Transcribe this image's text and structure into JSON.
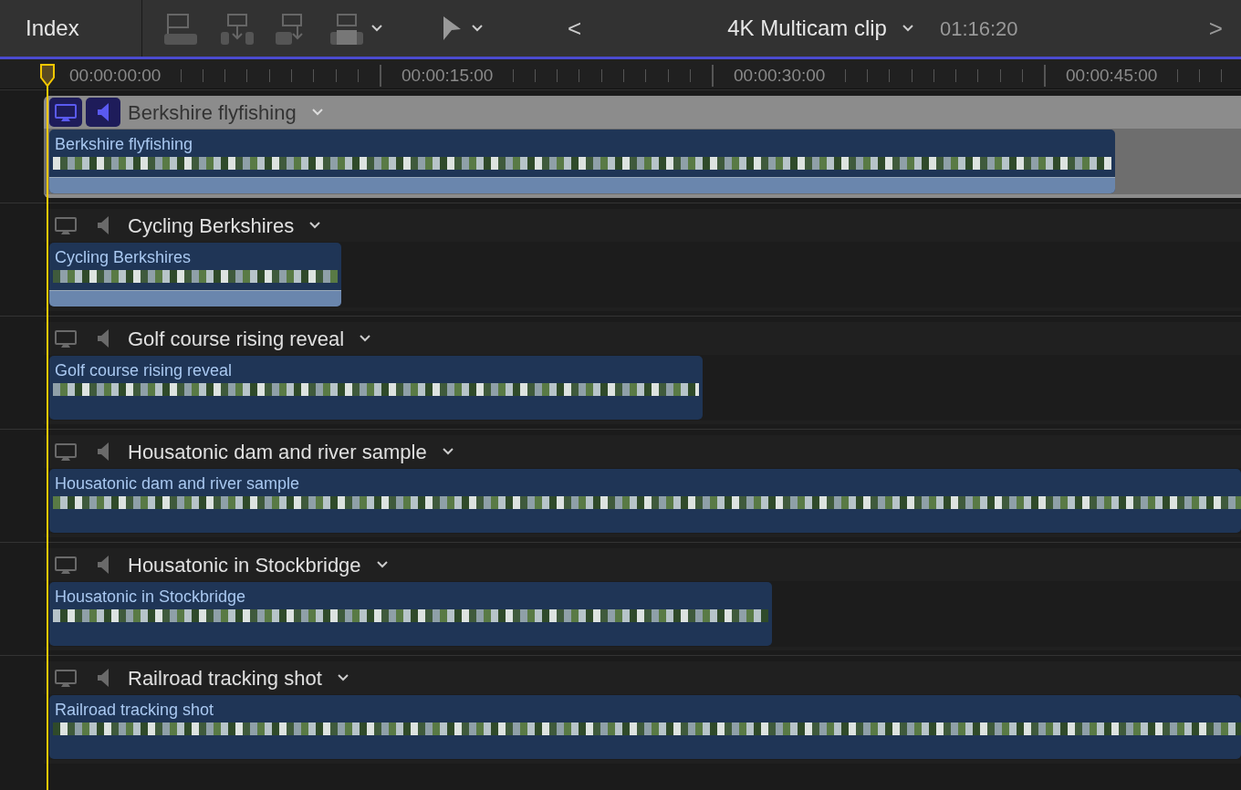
{
  "toolbar": {
    "index_button": "Index",
    "clip_title": "4K Multicam clip",
    "duration": "01:16:20",
    "back_button": "<",
    "forward_button": ">"
  },
  "ruler": {
    "timecodes": [
      "00:00:00:00",
      "00:00:15:00",
      "00:00:30:00",
      "00:00:45:00"
    ]
  },
  "angles": [
    {
      "name": "Berkshire flyfishing",
      "clip_title": "Berkshire flyfishing",
      "selected": true,
      "audio_waveform": true
    },
    {
      "name": "Cycling Berkshires",
      "clip_title": "Cycling Berkshires",
      "selected": false,
      "audio_waveform": true
    },
    {
      "name": "Golf course rising reveal",
      "clip_title": "Golf course rising reveal",
      "selected": false,
      "audio_waveform": false
    },
    {
      "name": "Housatonic dam and river sample",
      "clip_title": "Housatonic dam and river sample",
      "selected": false,
      "audio_waveform": false
    },
    {
      "name": "Housatonic in Stockbridge",
      "clip_title": "Housatonic in Stockbridge",
      "selected": false,
      "audio_waveform": false
    },
    {
      "name": "Railroad tracking shot",
      "clip_title": "Railroad tracking shot",
      "selected": false,
      "audio_waveform": false
    }
  ]
}
